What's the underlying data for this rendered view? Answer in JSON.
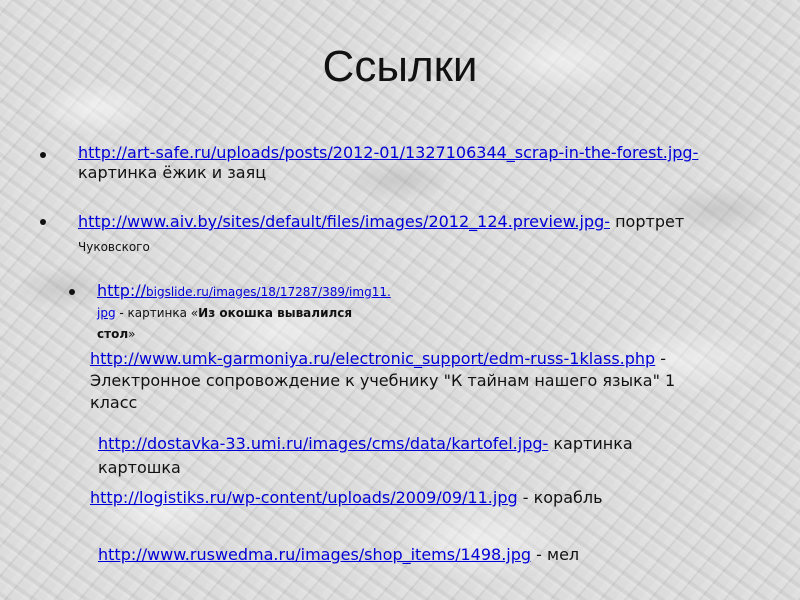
{
  "title": "Ссылки",
  "links": [
    {
      "url": "http://art-safe.ru/uploads/posts/2012-01/1327106344_scrap-in-the-forest.jpg-",
      "desc": "картинка ёжик и заяц"
    },
    {
      "url": "http://www.aiv.by/sites/default/files/images/2012_124.preview.jpg-",
      "desc1": " портрет",
      "desc2": "Чуковского"
    },
    {
      "url_a": "http://",
      "url_b": "bigslide.ru/images/18/17287/389/img11.",
      "url_c": "jpg",
      "desc_a": " - картинка «",
      "desc_b": "Из окошка вывалился",
      "desc_c": "стол",
      "desc_d": "»"
    },
    {
      "url": "http://www.umk-garmoniya.ru/electronic_support/edm-russ-1klass.php",
      "desc": " - Электронное сопровождение к учебнику \"К тайнам нашего языка\" 1 класс"
    },
    {
      "url": "http://dostavka-33.umi.ru/images/cms/data/kartofel.jpg-",
      "desc": " картинка картошка"
    },
    {
      "url": "http://logistiks.ru/wp-content/uploads/2009/09/11.jpg",
      "desc": " - корабль"
    },
    {
      "url": "http://www.ruswedma.ru/images/shop_items/1498.jpg",
      "desc": " - мел"
    }
  ]
}
